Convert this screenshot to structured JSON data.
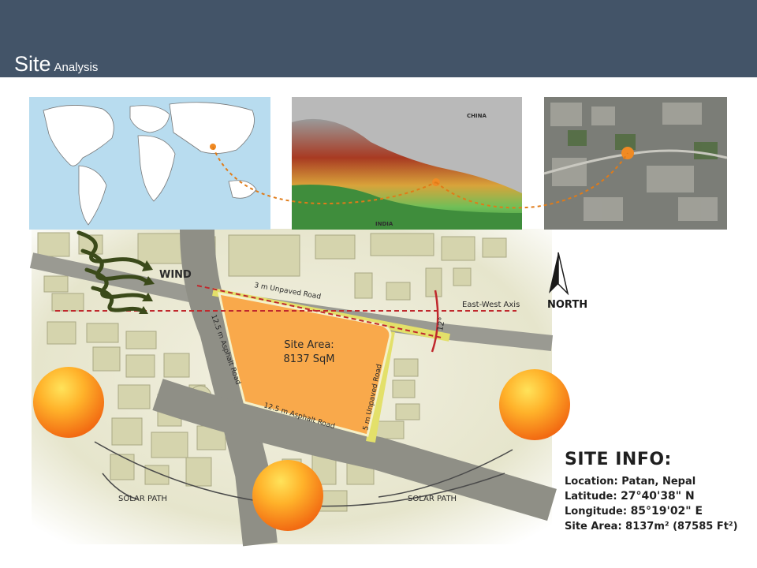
{
  "header": {
    "title_main": "Site",
    "title_sub": "Analysis"
  },
  "maps": {
    "china_label": "CHINA",
    "india_label": "INDIA"
  },
  "diagram": {
    "wind_label": "WIND",
    "north_label": "NORTH",
    "axis_label": "East-West Axis",
    "angle_label": "12°",
    "road_top": "3 m Unpaved Road",
    "road_left": "12.5 m Asphalt Road",
    "road_bottom": "12.5 m Asphalt Road",
    "road_right": "5 m Unpaved Road",
    "site_area_line1": "Site Area:",
    "site_area_line2": "8137 SqM",
    "solar_path_left": "SOLAR PATH",
    "solar_path_right": "SOLAR PATH"
  },
  "site_info": {
    "heading": "SITE INFO:",
    "location_label": "Location:",
    "location_value": "Patan, Nepal",
    "latitude_label": "Latitude:",
    "latitude_value": "27°40'38\" N",
    "longitude_label": "Longitude:",
    "longitude_value": "85°19'02\" E",
    "area_label": "Site Area:",
    "area_value": "8137m² (87585 Ft²)"
  },
  "colors": {
    "header": "#435468",
    "site": "#f9a94b",
    "marker": "#f08a24",
    "axis": "#c0282d",
    "wind": "#3b4a1a",
    "road": "#8f8f86"
  }
}
